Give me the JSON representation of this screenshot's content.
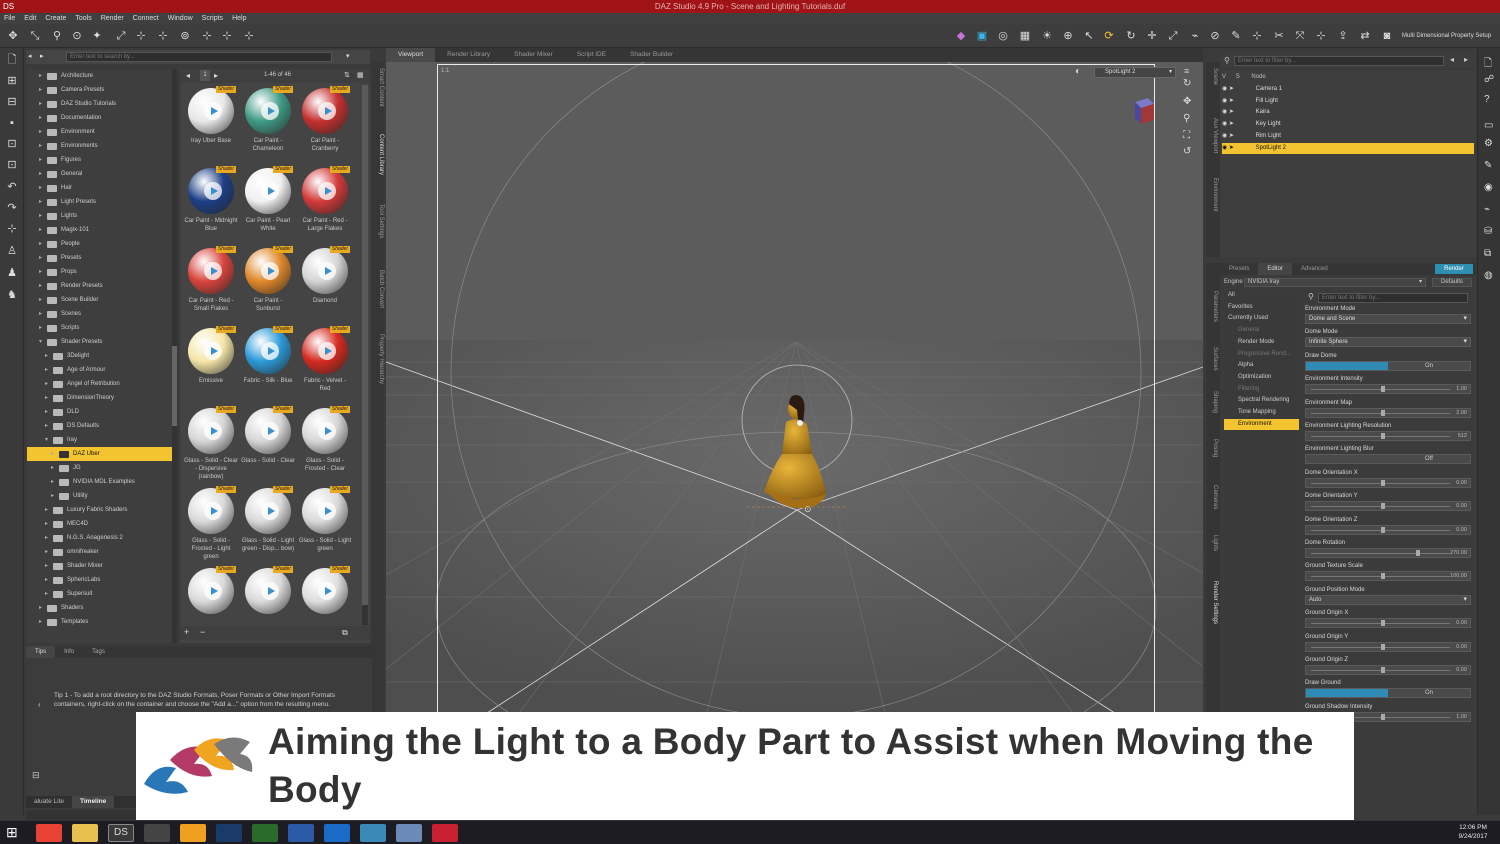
{
  "window": {
    "title": "DAZ Studio 4.9 Pro - Scene and Lighting Tutorials.duf",
    "app_icon": "DS"
  },
  "menubar": [
    "File",
    "Edit",
    "Create",
    "Tools",
    "Render",
    "Connect",
    "Window",
    "Scripts",
    "Help"
  ],
  "toolbar": {
    "property_setup": "Multi Dimensional Property Setup"
  },
  "content_library": {
    "search_placeholder": "Enter text to search by...",
    "page_info": "1-46 of 46",
    "tree": [
      {
        "label": "Architecture",
        "level": 1,
        "expanded": false
      },
      {
        "label": "Camera Presets",
        "level": 1,
        "expanded": false
      },
      {
        "label": "DAZ Studio Tutorials",
        "level": 1,
        "expanded": false
      },
      {
        "label": "Documentation",
        "level": 1,
        "expanded": false
      },
      {
        "label": "Environment",
        "level": 1,
        "expanded": false
      },
      {
        "label": "Environments",
        "level": 1,
        "expanded": false
      },
      {
        "label": "Figures",
        "level": 1,
        "expanded": false
      },
      {
        "label": "General",
        "level": 1,
        "expanded": false
      },
      {
        "label": "Hair",
        "level": 1,
        "expanded": false
      },
      {
        "label": "Light Presets",
        "level": 1,
        "expanded": false
      },
      {
        "label": "Lights",
        "level": 1,
        "expanded": false
      },
      {
        "label": "Magix-101",
        "level": 1,
        "expanded": false
      },
      {
        "label": "People",
        "level": 1,
        "expanded": false
      },
      {
        "label": "Presets",
        "level": 1,
        "expanded": false
      },
      {
        "label": "Props",
        "level": 1,
        "expanded": false
      },
      {
        "label": "Render Presets",
        "level": 1,
        "expanded": false
      },
      {
        "label": "Scene Builder",
        "level": 1,
        "expanded": false
      },
      {
        "label": "Scenes",
        "level": 1,
        "expanded": false
      },
      {
        "label": "Scripts",
        "level": 1,
        "expanded": false
      },
      {
        "label": "Shader Presets",
        "level": 1,
        "expanded": true
      },
      {
        "label": "3Delight",
        "level": 2,
        "expanded": false
      },
      {
        "label": "Age of Armour",
        "level": 2,
        "expanded": false
      },
      {
        "label": "Angel of Retribution",
        "level": 2,
        "expanded": false
      },
      {
        "label": "DimensionTheory",
        "level": 2,
        "expanded": false
      },
      {
        "label": "DLD",
        "level": 2,
        "expanded": false
      },
      {
        "label": "DS Defaults",
        "level": 2,
        "expanded": false
      },
      {
        "label": "Iray",
        "level": 2,
        "expanded": true
      },
      {
        "label": "DAZ Uber",
        "level": 3,
        "expanded": false,
        "selected": true
      },
      {
        "label": "JG",
        "level": 3,
        "expanded": false
      },
      {
        "label": "NVIDIA MDL Examples",
        "level": 3,
        "expanded": false
      },
      {
        "label": "Utility",
        "level": 3,
        "expanded": false
      },
      {
        "label": "Luxury Fabric Shaders",
        "level": 2,
        "expanded": false
      },
      {
        "label": "MEC4D",
        "level": 2,
        "expanded": false
      },
      {
        "label": "N.G.S. Anagenesis 2",
        "level": 2,
        "expanded": false
      },
      {
        "label": "omnifreaker",
        "level": 2,
        "expanded": false
      },
      {
        "label": "Shader Mixer",
        "level": 2,
        "expanded": false
      },
      {
        "label": "SphericLabs",
        "level": 2,
        "expanded": false
      },
      {
        "label": "Supersuit",
        "level": 2,
        "expanded": false
      },
      {
        "label": "Shaders",
        "level": 1,
        "expanded": false
      },
      {
        "label": "Templates",
        "level": 1,
        "expanded": false
      }
    ],
    "tiles": [
      {
        "label": "Iray Uber Base",
        "color": "#e8e8e8",
        "badge": "Shader"
      },
      {
        "label": "Car Paint - Chameleon",
        "color": "#3f9a86",
        "badge": "Shader"
      },
      {
        "label": "Car Paint - Cranberry",
        "color": "#c53030",
        "badge": "Shader"
      },
      {
        "label": "Car Paint - Midnight Blue",
        "color": "#1d3f86",
        "badge": "Shader"
      },
      {
        "label": "Car Paint - Pearl White",
        "color": "#f0f0f0",
        "badge": "Shader"
      },
      {
        "label": "Car Paint - Red - Large Flakes",
        "color": "#d33a3a",
        "badge": "Shader"
      },
      {
        "label": "Car Paint - Red - Small Flakes",
        "color": "#d8443c",
        "badge": "Shader"
      },
      {
        "label": "Car Paint - Sunburst",
        "color": "#e0882a",
        "badge": "Shader"
      },
      {
        "label": "Diamond",
        "color": "#d4d4d4",
        "badge": "Shader"
      },
      {
        "label": "Emissive",
        "color": "#f5e6a8",
        "badge": "Shader"
      },
      {
        "label": "Fabric - Silk - Blue",
        "color": "#2c9ad8",
        "badge": "Shader"
      },
      {
        "label": "Fabric - Velvet - Red",
        "color": "#d62a20",
        "badge": "Shader"
      },
      {
        "label": "Glass - Solid - Clear - Dispersive (rainbow)",
        "color": "#d6d6d6",
        "badge": "Shader"
      },
      {
        "label": "Glass - Solid - Clear",
        "color": "#d6d6d6",
        "badge": "Shader"
      },
      {
        "label": "Glass - Solid - Frosted - Clear",
        "color": "#d6d6d6",
        "badge": "Shader"
      },
      {
        "label": "Glass - Solid - Frosted - Light green",
        "color": "#dadada",
        "badge": "Shader"
      },
      {
        "label": "Glass - Solid - Light green - Disp... bow)",
        "color": "#dadada",
        "badge": "Shader"
      },
      {
        "label": "Glass - Solid - Light green",
        "color": "#dadada",
        "badge": "Shader"
      },
      {
        "label": "",
        "color": "#dadada",
        "badge": "Shader"
      },
      {
        "label": "",
        "color": "#dadada",
        "badge": "Shader"
      },
      {
        "label": "",
        "color": "#dedede",
        "badge": "Shader"
      }
    ],
    "tips_tabs": [
      "Tips",
      "Info",
      "Tags"
    ],
    "tip_text": "Tip 1 - To add a root directory to the DAZ Studio Formats, Poser Formats or Other Import Formats containers, right-click on the container and choose the \"Add a...\" option from the resulting menu.",
    "bottom_tabs": [
      "aluate Lite",
      "Timeline"
    ]
  },
  "side_tabs": [
    "Smart Content",
    "Content Library",
    "Tool Settings",
    "Batch Convert",
    "Property Hierarchy"
  ],
  "viewport": {
    "tabs": [
      "Viewport",
      "Render Library",
      "Shader Mixer",
      "Script IDE",
      "Shader Builder"
    ],
    "active_tab": "Viewport",
    "camera": "SpotLight 2",
    "ratio": "1:1"
  },
  "scene": {
    "filter_placeholder": "Enter text to filter by...",
    "header": [
      "V",
      "S",
      "Node"
    ],
    "side_tabs": [
      "Scene",
      "Aux Viewport",
      "Environment"
    ],
    "nodes": [
      {
        "label": "Camera 1",
        "selected": false
      },
      {
        "label": "Fill Light",
        "selected": false
      },
      {
        "label": "Kaira",
        "selected": false
      },
      {
        "label": "Key Light",
        "selected": false
      },
      {
        "label": "Rim Light",
        "selected": false
      },
      {
        "label": "SpotLight 2",
        "selected": true
      }
    ]
  },
  "render_settings": {
    "tabs": [
      "Presets",
      "Editor",
      "Advanced"
    ],
    "active_tab": "Editor",
    "render_label": "Render",
    "engine_label": "Engine",
    "engine_value": "NVIDIA Iray",
    "defaults_label": "Defaults",
    "filter_placeholder": "Enter text to filter by...",
    "side_tabs": [
      "Parameters",
      "Surfaces",
      "Shaping",
      "Posing",
      "Cameras",
      "Lights",
      "Render Settings"
    ],
    "groups": [
      {
        "label": "All",
        "dim": false,
        "selected": false
      },
      {
        "label": "Favorites",
        "dim": false,
        "selected": false
      },
      {
        "label": "Currently Used",
        "dim": false,
        "selected": false
      },
      {
        "label": "General",
        "dim": true,
        "selected": false
      },
      {
        "label": "Render Mode",
        "dim": false,
        "selected": false
      },
      {
        "label": "Progressive Rend...",
        "dim": true,
        "selected": false
      },
      {
        "label": "Alpha",
        "dim": false,
        "selected": false
      },
      {
        "label": "Optimization",
        "dim": false,
        "selected": false
      },
      {
        "label": "Filtering",
        "dim": true,
        "selected": false
      },
      {
        "label": "Spectral Rendering",
        "dim": false,
        "selected": false
      },
      {
        "label": "Tone Mapping",
        "dim": false,
        "selected": false
      },
      {
        "label": "Environment",
        "dim": false,
        "selected": true
      }
    ],
    "properties": [
      {
        "label": "Environment Mode",
        "type": "dropdown",
        "value": "Dome and Scene"
      },
      {
        "label": "Dome Mode",
        "type": "dropdown",
        "value": "Infinite Sphere"
      },
      {
        "label": "Draw Dome",
        "type": "toggle",
        "value": "On"
      },
      {
        "label": "Environment Intensity",
        "type": "slider",
        "value": "1.00",
        "frac": 0.5
      },
      {
        "label": "Environment Map",
        "type": "slider",
        "value": "2.00",
        "frac": 0.5
      },
      {
        "label": "Environment Lighting Resolution",
        "type": "slider",
        "value": "512",
        "frac": 0.5
      },
      {
        "label": "Environment Lighting Blur",
        "type": "toggle",
        "value": "Off"
      },
      {
        "label": "Dome Orientation X",
        "type": "slider",
        "value": "0.00",
        "frac": 0.5
      },
      {
        "label": "Dome Orientation Y",
        "type": "slider",
        "value": "0.00",
        "frac": 0.5
      },
      {
        "label": "Dome Orientation Z",
        "type": "slider",
        "value": "0.00",
        "frac": 0.5
      },
      {
        "label": "Dome Rotation",
        "type": "slider",
        "value": "270.00",
        "frac": 0.75
      },
      {
        "label": "Ground Texture Scale",
        "type": "slider",
        "value": "100.00",
        "frac": 0.5
      },
      {
        "label": "Ground Position Mode",
        "type": "dropdown",
        "value": "Auto"
      },
      {
        "label": "Ground Origin X",
        "type": "slider",
        "value": "0.00",
        "frac": 0.5
      },
      {
        "label": "Ground Origin Y",
        "type": "slider",
        "value": "0.00",
        "frac": 0.5
      },
      {
        "label": "Ground Origin Z",
        "type": "slider",
        "value": "0.00",
        "frac": 0.5
      },
      {
        "label": "Draw Ground",
        "type": "toggle",
        "value": "On"
      },
      {
        "label": "Ground Shadow Intensity",
        "type": "slider",
        "value": "1.00",
        "frac": 0.5
      }
    ]
  },
  "banner": {
    "title": "Aiming the Light to a Body Part to Assist when Moving the Body"
  },
  "taskbar": {
    "time": "12:06 PM",
    "date": "9/24/2017"
  }
}
